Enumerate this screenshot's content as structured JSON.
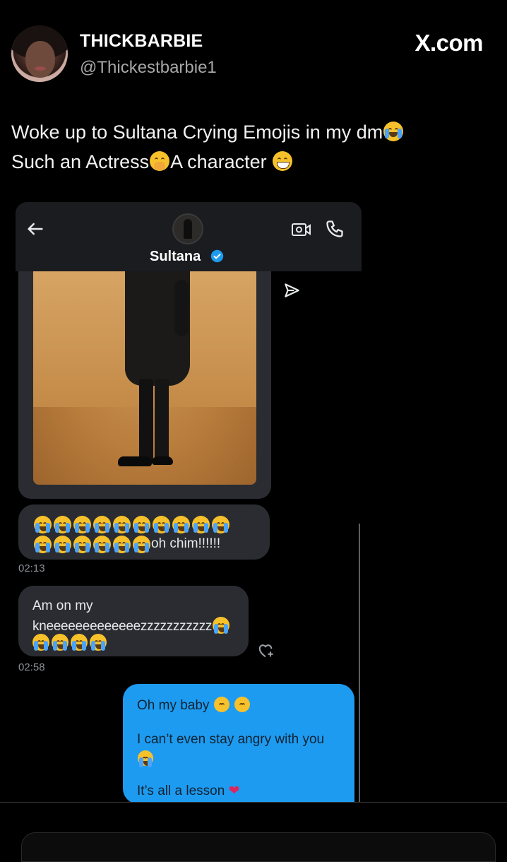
{
  "post": {
    "display_name": "THICKBARBIE",
    "handle": "@Thickestbarbie1",
    "brand": "X.com",
    "text_line1": "Woke up to Sultana Crying Emojis in my dm",
    "text_line2_a": "Such an Actress",
    "text_line2_b": "A character"
  },
  "dm": {
    "contact_name": "Sultana",
    "messages": {
      "emoji_caption": "oh chim!!!!!!",
      "time_1": "02:13",
      "knee_line1": "Am on my",
      "knee_line2": "kneeeeeeeeeeeeezzzzzzzzzzz",
      "time_2": "02:58",
      "reply_line1": "Oh my baby",
      "reply_line2": "I can’t even stay angry with you",
      "reply_line3": "It’s all a lesson"
    }
  },
  "icons": {
    "back": "arrow-left-icon",
    "video": "video-call-icon",
    "call": "phone-icon",
    "verified": "verified-badge-icon",
    "send": "send-icon",
    "react": "add-reaction-icon"
  },
  "colors": {
    "background": "#000000",
    "bubble_in": "#2a2c31",
    "bubble_out": "#1d9bf0",
    "verified": "#1d9bf0"
  }
}
